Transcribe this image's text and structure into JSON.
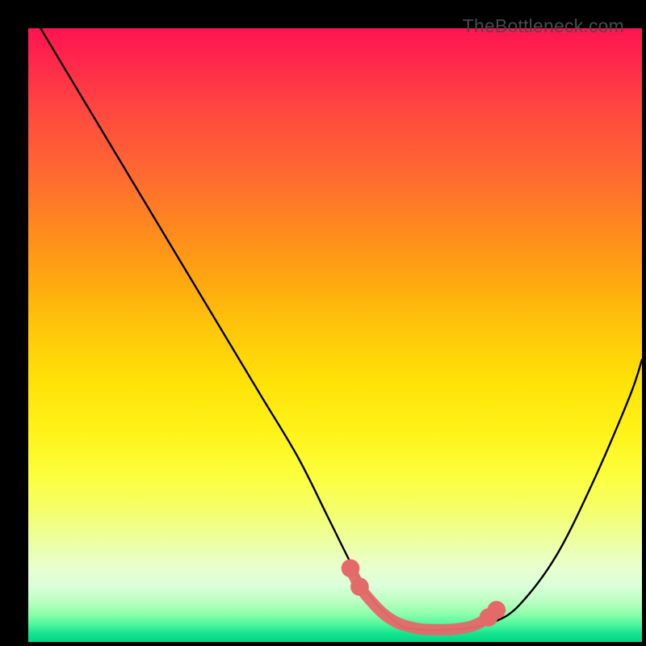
{
  "watermark": "TheBottleneck.com",
  "chart_data": {
    "type": "line",
    "title": "",
    "xlabel": "",
    "ylabel": "",
    "xlim": [
      0,
      100
    ],
    "ylim": [
      0,
      100
    ],
    "grid": false,
    "legend": false,
    "series": [
      {
        "name": "bottleneck-curve",
        "color": "#000000",
        "x": [
          2,
          8,
          14,
          20,
          26,
          32,
          38,
          44,
          49,
          53,
          56,
          59,
          61,
          64,
          68,
          72,
          76,
          80,
          86,
          92,
          98,
          100
        ],
        "y": [
          100,
          90,
          80,
          70,
          60,
          50,
          40,
          30,
          20,
          12,
          7,
          4,
          2.5,
          2,
          2,
          2.3,
          3.3,
          6,
          14,
          26,
          40,
          46
        ]
      },
      {
        "name": "highlight-band",
        "color": "#e46a6a",
        "x": [
          52.5,
          54,
          56,
          58,
          60,
          62,
          64,
          66,
          68,
          70,
          72,
          73.5,
          75,
          76.3
        ],
        "y": [
          12,
          9,
          6.5,
          4.5,
          3.2,
          2.5,
          2.1,
          2.0,
          2.0,
          2.15,
          2.5,
          3.1,
          4.0,
          5.2
        ]
      }
    ],
    "markers": [
      {
        "x": 52.5,
        "y": 12,
        "r": 1.4,
        "color": "#e46a6a"
      },
      {
        "x": 54.0,
        "y": 9,
        "r": 1.4,
        "color": "#e46a6a"
      },
      {
        "x": 75.0,
        "y": 4.0,
        "r": 1.4,
        "color": "#e46a6a"
      },
      {
        "x": 76.3,
        "y": 5.2,
        "r": 1.4,
        "color": "#e46a6a"
      }
    ]
  }
}
